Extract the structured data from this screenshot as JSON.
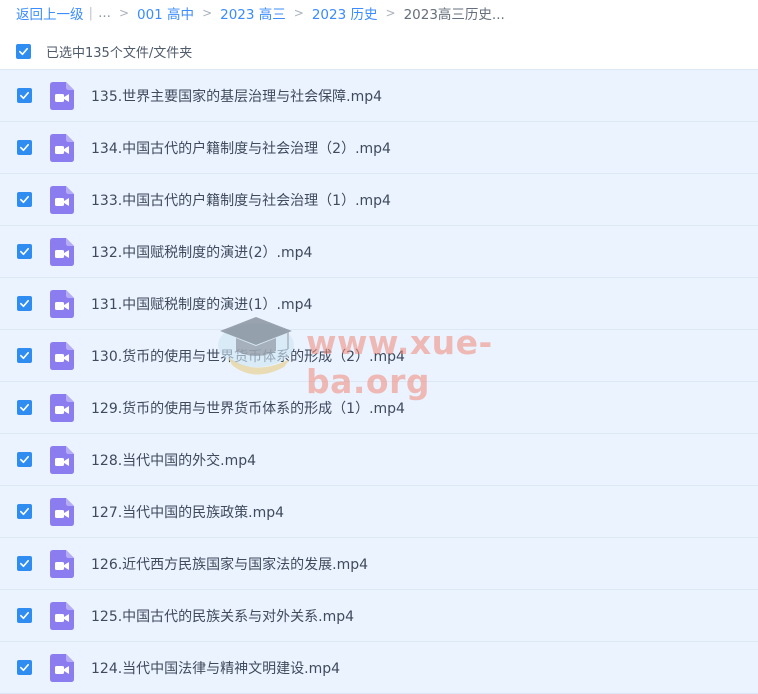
{
  "breadcrumb": {
    "back_label": "返回上一级",
    "ellipsis": "...",
    "items": [
      "001 高中",
      "2023 高三",
      "2023 历史"
    ],
    "current": "2023高三历史..."
  },
  "selection": {
    "label": "已选中135个文件/文件夹",
    "checked": true
  },
  "files": [
    {
      "name": "135.世界主要国家的基层治理与社会保障.mp4",
      "checked": true
    },
    {
      "name": "134.中国古代的户籍制度与社会治理（2）.mp4",
      "checked": true
    },
    {
      "name": "133.中国古代的户籍制度与社会治理（1）.mp4",
      "checked": true
    },
    {
      "name": "132.中国赋税制度的演进(2）.mp4",
      "checked": true
    },
    {
      "name": "131.中国赋税制度的演进(1）.mp4",
      "checked": true
    },
    {
      "name": "130.货币的使用与世界货币体系的形成（2）.mp4",
      "checked": true
    },
    {
      "name": "129.货币的使用与世界货币体系的形成（1）.mp4",
      "checked": true
    },
    {
      "name": "128.当代中国的外交.mp4",
      "checked": true
    },
    {
      "name": "127.当代中国的民族政策.mp4",
      "checked": true
    },
    {
      "name": "126.近代西方民族国家与国家法的发展.mp4",
      "checked": true
    },
    {
      "name": "125.中国古代的民族关系与对外关系.mp4",
      "checked": true
    },
    {
      "name": "124.当代中国法律与精神文明建设.mp4",
      "checked": true
    }
  ],
  "watermark": {
    "text": "www.xue-ba.org"
  },
  "colors": {
    "accent": "#2f8cf0",
    "link": "#3b8cff",
    "row_selected": "#eaf3ff",
    "video_icon": "#8b7cf0"
  },
  "icons": {
    "checkbox": "checkmark-icon",
    "file": "video-file-icon"
  }
}
